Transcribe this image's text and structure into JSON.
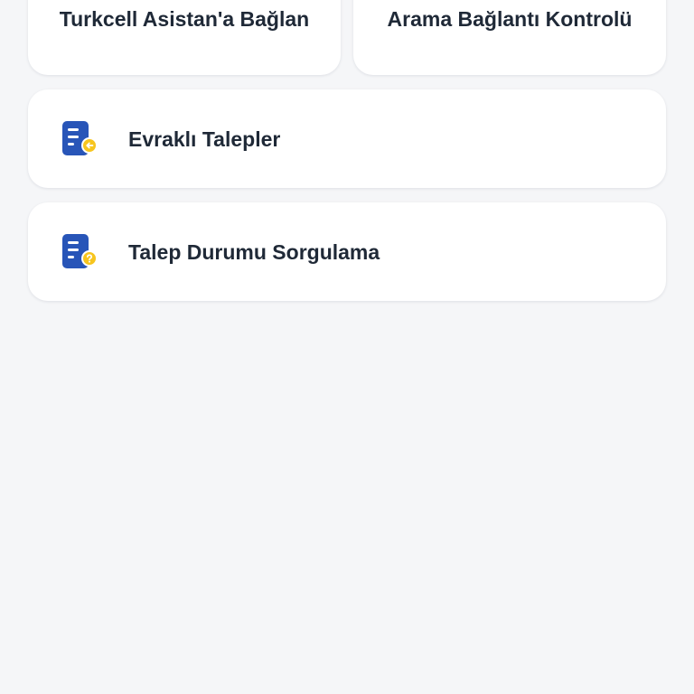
{
  "tiles": [
    {
      "label": "Turkcell Asistan'a Bağlan"
    },
    {
      "label": "Arama Bağlantı Kontrolü"
    }
  ],
  "rows": [
    {
      "label": "Evraklı Talepler",
      "icon": "document-arrow-icon"
    },
    {
      "label": "Talep Durumu Sorgulama",
      "icon": "document-question-icon"
    }
  ],
  "colors": {
    "background": "#f5f6f8",
    "card": "#ffffff",
    "text": "#1f2937",
    "icon_blue": "#2855b8",
    "icon_yellow": "#f7c51e"
  }
}
